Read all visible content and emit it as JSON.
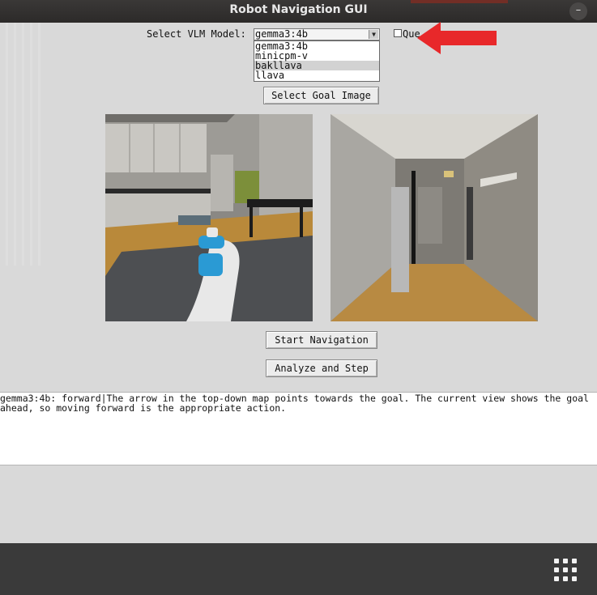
{
  "window": {
    "title": "Robot Navigation GUI",
    "minimize_glyph": "–"
  },
  "model_select": {
    "label": "Select VLM Model:",
    "selected": "gemma3:4b",
    "options": [
      "gemma3:4b",
      "minicpm-v",
      "bakllava",
      "llava"
    ],
    "highlighted_option": "bakllava"
  },
  "queue_checkbox": {
    "label": "Que",
    "checked": false
  },
  "buttons": {
    "select_goal_image": "Select Goal Image",
    "start_navigation": "Start Navigation",
    "analyze_and_step": "Analyze and Step"
  },
  "output": {
    "text": "gemma3:4b: forward|The arrow in the top-down map points towards the goal. The current view shows the goal ahead, so moving forward is the appropriate action."
  },
  "colors": {
    "background": "#d9d9d9",
    "annotation_arrow": "#e8282a",
    "titlebar": "#2f2d2c",
    "dock": "#3a3a3a"
  },
  "icons": {
    "dropdown": "triangle-down-icon",
    "annotation": "red-arrow-icon",
    "apps": "app-grid-icon",
    "minimize": "minimize-icon"
  }
}
